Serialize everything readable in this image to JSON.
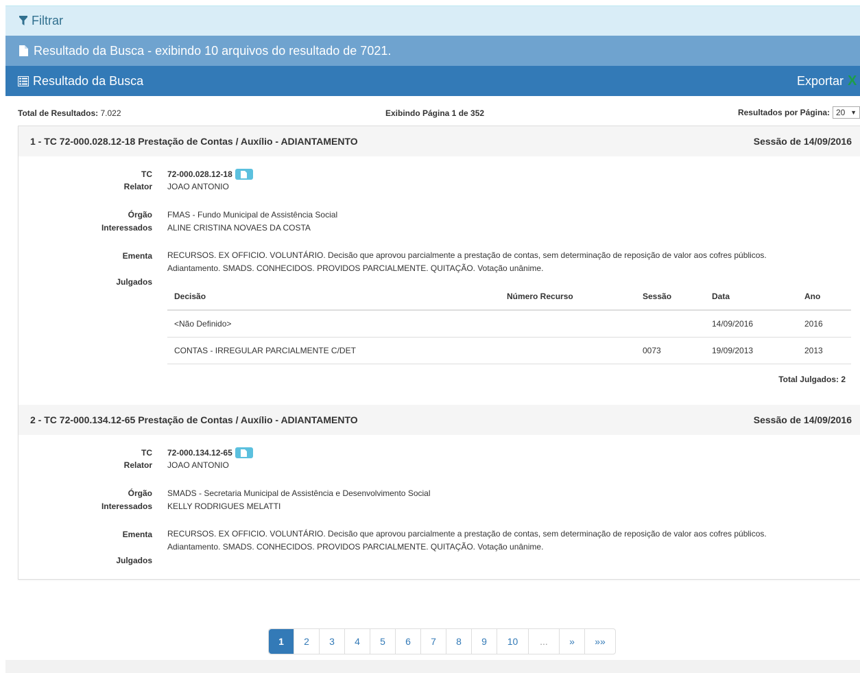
{
  "filter": {
    "label": "Filtrar"
  },
  "info": {
    "text": "Resultado da Busca - exibindo 10 arquivos do resultado de 7021."
  },
  "results": {
    "title": "Resultado da Busca",
    "export_label": "Exportar",
    "total_label": "Total de Resultados:",
    "total_value": "7.022",
    "page_info": "Exibindo Página 1 de 352",
    "per_page_label": "Resultados por Página:",
    "per_page_value": "20"
  },
  "labels": {
    "tc": "TC",
    "relator": "Relator",
    "orgao": "Órgão",
    "interessados": "Interessados",
    "ementa": "Ementa",
    "julgados": "Julgados"
  },
  "table_headers": [
    "Decisão",
    "Número Recurso",
    "Sessão",
    "Data",
    "Ano"
  ],
  "items": [
    {
      "title": "1 - TC 72-000.028.12-18 Prestação de Contas / Auxílio - ADIANTAMENTO",
      "session": "Sessão de 14/09/2016",
      "tc": "72-000.028.12-18",
      "relator": "JOAO ANTONIO",
      "orgao": "FMAS - Fundo Municipal de Assistência Social",
      "interessados": "ALINE CRISTINA NOVAES DA COSTA",
      "ementa_1": "RECURSOS. EX OFFICIO. VOLUNTÁRIO. Decisão que aprovou parcialmente a prestação de contas, sem determinação de reposição de valor aos cofres públicos.",
      "ementa_2": "Adiantamento. SMADS. CONHECIDOS. PROVIDOS PARCIALMENTE. QUITAÇÃO. Votação unânime.",
      "julgados": [
        {
          "decisao": "<Não Definido>",
          "numero": "",
          "sessao": "",
          "data": "14/09/2016",
          "ano": "2016"
        },
        {
          "decisao": "CONTAS - IRREGULAR PARCIALMENTE C/DET",
          "numero": "",
          "sessao": "0073",
          "data": "19/09/2013",
          "ano": "2013"
        }
      ],
      "total_julgados": "Total Julgados: 2"
    },
    {
      "title": "2 - TC 72-000.134.12-65 Prestação de Contas / Auxílio - ADIANTAMENTO",
      "session": "Sessão de 14/09/2016",
      "tc": "72-000.134.12-65",
      "relator": "JOAO ANTONIO",
      "orgao": "SMADS - Secretaria Municipal de Assistência e Desenvolvimento Social",
      "interessados": "KELLY RODRIGUES MELATTI",
      "ementa_1": "RECURSOS. EX OFFICIO. VOLUNTÁRIO. Decisão que aprovou parcialmente a prestação de contas, sem determinação de reposição de valor aos cofres públicos.",
      "ementa_2": "Adiantamento. SMADS. CONHECIDOS. PROVIDOS PARCIALMENTE. QUITAÇÃO. Votação unânime."
    }
  ],
  "pagination": [
    "1",
    "2",
    "3",
    "4",
    "5",
    "6",
    "7",
    "8",
    "9",
    "10",
    "...",
    "»",
    "»»"
  ],
  "colors": {
    "primary": "#337ab7",
    "info_bar": "#6fa3cf",
    "filter_bg": "#d9edf7",
    "button_info": "#5bc0de",
    "excel_green": "#1d9e47"
  }
}
